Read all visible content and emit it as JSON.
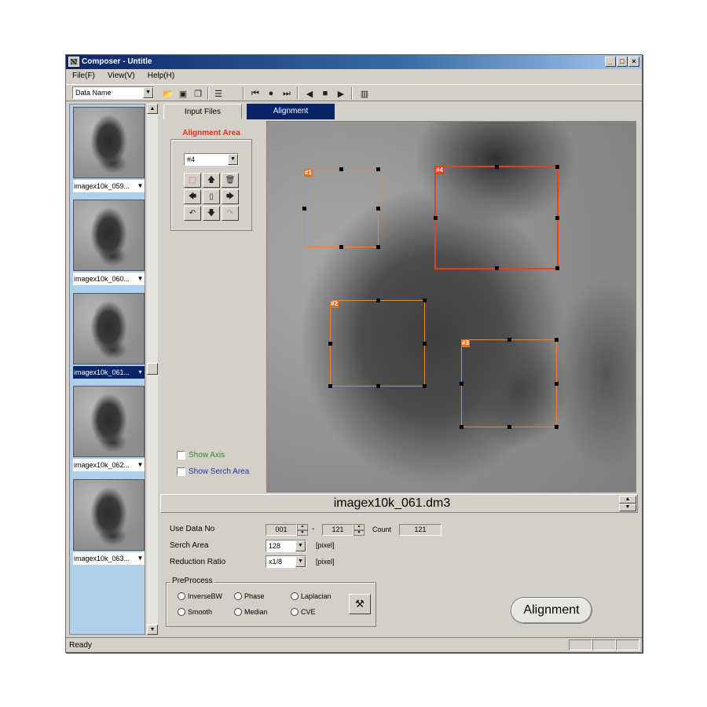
{
  "window": {
    "title": "Composer - Untitle"
  },
  "menu": [
    "File(F)",
    "View(V)",
    "Help(H)"
  ],
  "toolbar": {
    "data_name_value": "Data Name"
  },
  "thumbnails": [
    {
      "name": "imagex10k_059...",
      "selected": false
    },
    {
      "name": "imagex10k_060...",
      "selected": false
    },
    {
      "name": "imagex10k_061...",
      "selected": true
    },
    {
      "name": "imagex10k_062...",
      "selected": false
    },
    {
      "name": "imagex10k_063...",
      "selected": false
    }
  ],
  "tabs": {
    "input_files": "Input Files",
    "alignment": "Alignment"
  },
  "alignment_area": {
    "title": "Alignment Area",
    "selected": "#4"
  },
  "checks": {
    "show_axis": "Show Axis",
    "show_search_area": "Show Serch Area"
  },
  "rois": [
    "#1",
    "#4",
    "#2",
    "#3"
  ],
  "viewer": {
    "filename": "imagex10k_061.dm3"
  },
  "params": {
    "use_data_no_label": "Use Data No",
    "from": "001",
    "dash": "-",
    "to": "121",
    "count_label": "Count",
    "count": "121",
    "search_area_label": "Serch Area",
    "search_area_value": "128",
    "unit1": "[pixel]",
    "reduction_label": "Reduction Ratio",
    "reduction_value": "x1/8",
    "unit2": "[pixel]"
  },
  "preprocess": {
    "title": "PreProcess",
    "options": [
      "InverseBW",
      "Phase",
      "Laplacian",
      "Smooth",
      "Median",
      "CVE"
    ]
  },
  "buttons": {
    "alignment": "Alignment"
  },
  "status": {
    "text": "Ready"
  },
  "colors": {
    "title_bar": "#0a246a",
    "accent_red": "#e8401c",
    "roi_orange": "#e08a3c",
    "thumb_panel": "#aed0ec"
  }
}
